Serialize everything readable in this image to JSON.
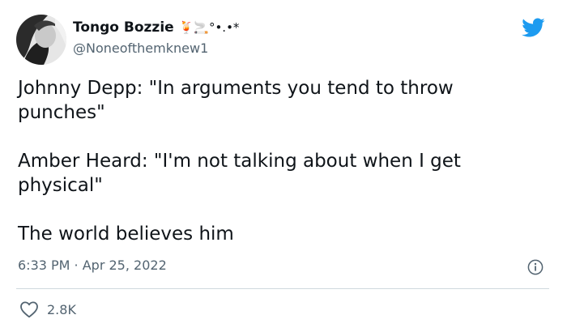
{
  "tweet": {
    "display_name": "Tongo Bozzie",
    "name_emoji": "🍹🚬°•.•*",
    "handle": "@Noneofthemknew1",
    "paragraphs": [
      "Johnny Depp: \"In arguments you tend to throw punches\"",
      "Amber Heard: \"I'm not talking about when I get physical\"",
      "The world believes him"
    ],
    "timestamp": "6:33 PM · Apr 25, 2022",
    "likes": "2.8K"
  },
  "icons": {
    "brand": "twitter-bird-icon",
    "info": "info-icon",
    "like": "heart-icon"
  },
  "colors": {
    "twitter_blue": "#1d9bf0",
    "text_primary": "#0f1419",
    "text_secondary": "#536471",
    "divider": "#cfd9de"
  }
}
